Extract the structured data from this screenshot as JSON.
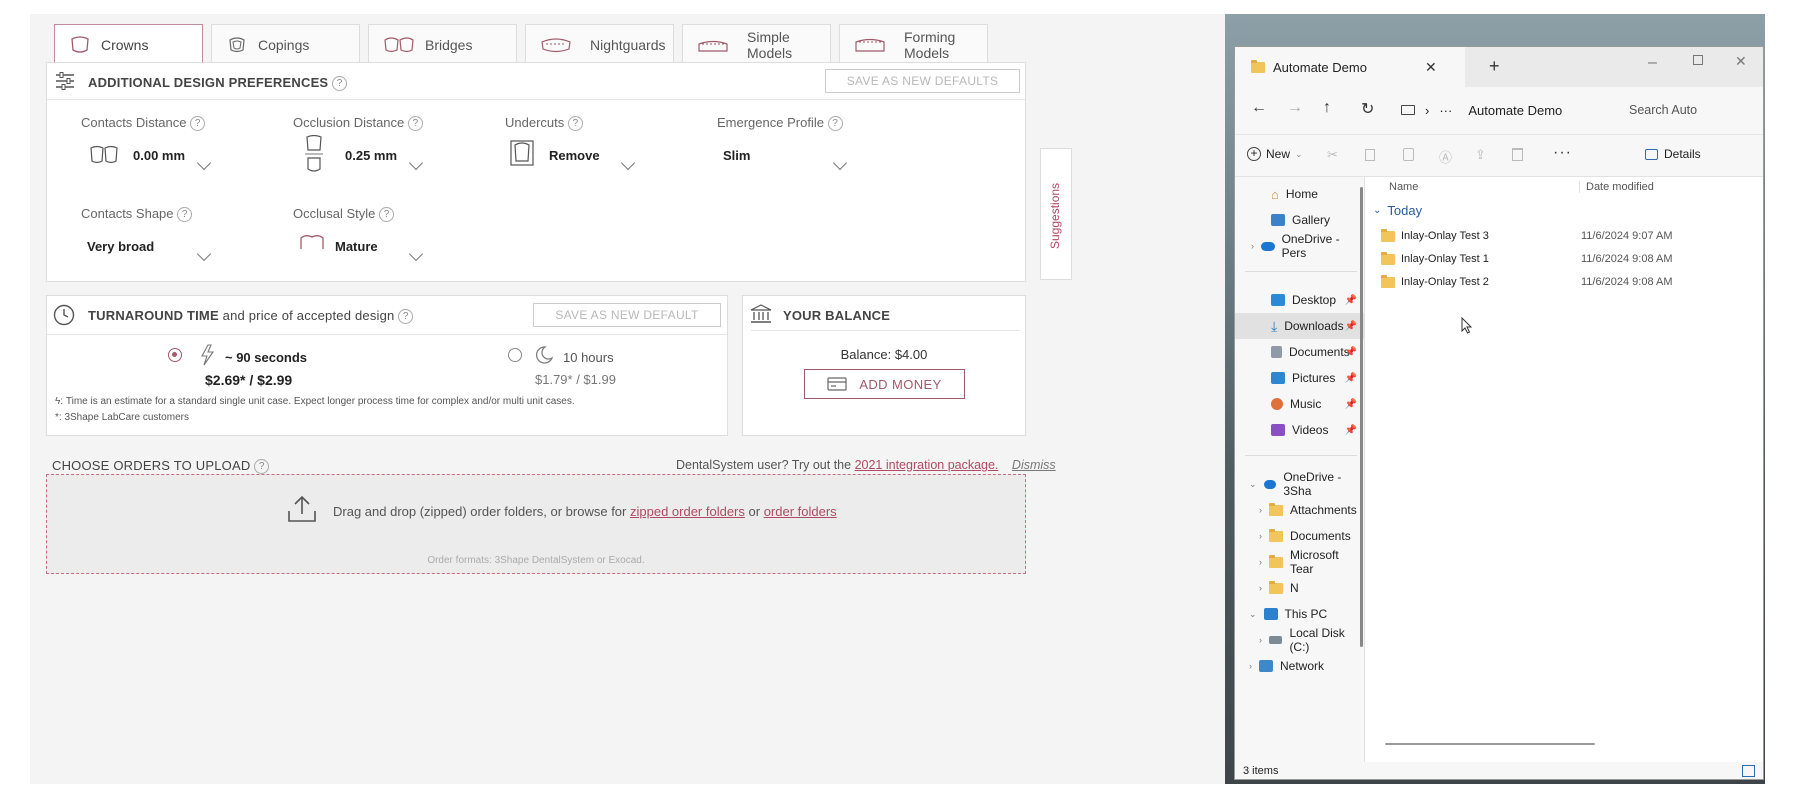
{
  "tabs": [
    {
      "label": "Crowns",
      "active": true
    },
    {
      "label": "Copings",
      "active": false
    },
    {
      "label": "Bridges",
      "active": false
    },
    {
      "label": "Nightguards",
      "active": false
    },
    {
      "label": "Simple Models",
      "active": false
    },
    {
      "label": "Forming Models",
      "active": false
    }
  ],
  "design": {
    "title": "ADDITIONAL DESIGN PREFERENCES",
    "save_label": "SAVE AS NEW DEFAULTS",
    "contacts_distance": {
      "label": "Contacts Distance",
      "value": "0.00 mm"
    },
    "occlusion_distance": {
      "label": "Occlusion Distance",
      "value": "0.25 mm"
    },
    "undercuts": {
      "label": "Undercuts",
      "value": "Remove"
    },
    "emergence_profile": {
      "label": "Emergence Profile",
      "value": "Slim"
    },
    "contacts_shape": {
      "label": "Contacts Shape",
      "value": "Very broad"
    },
    "occlusal_style": {
      "label": "Occlusal Style",
      "value": "Mature"
    }
  },
  "suggestions_label": "Suggestions",
  "turnaround": {
    "title_bold": "TURNAROUND TIME",
    "title_rest": " and price of accepted design",
    "save_label": "SAVE AS NEW DEFAULT",
    "option1": {
      "time": "~ 90 seconds",
      "price": "$2.69* / $2.99",
      "selected": true
    },
    "option2": {
      "time": "10 hours",
      "price": "$1.79* / $1.99",
      "selected": false
    },
    "note1": ": Time is an estimate for a standard single unit case. Expect longer process time for complex and/or multi unit cases.",
    "note2": "*: 3Shape LabCare customers"
  },
  "balance": {
    "title": "YOUR BALANCE",
    "text": "Balance: $4.00",
    "add_money": "ADD MONEY"
  },
  "upload": {
    "title": "CHOOSE ORDERS TO UPLOAD",
    "prompt": "DentalSystem user? Try out the ",
    "integration_link": "2021 integration package.",
    "dismiss": "Dismiss",
    "drop_text": "Drag and drop (zipped) order folders, or browse for ",
    "zipped_link": "zipped order folders",
    "or_text": " or ",
    "folders_link": "order folders",
    "formats": "Order formats: 3Shape DentalSystem or Exocad."
  },
  "explorer": {
    "tab_title": "Automate Demo",
    "breadcrumb": "Automate Demo",
    "search_placeholder": "Search Auto",
    "new_label": "New",
    "details_label": "Details",
    "col_name": "Name",
    "col_date": "Date modified",
    "group": "Today",
    "files": [
      {
        "name": "Inlay-Onlay Test 3",
        "date": "11/6/2024 9:07 AM"
      },
      {
        "name": "Inlay-Onlay Test 1",
        "date": "11/6/2024 9:08 AM"
      },
      {
        "name": "Inlay-Onlay Test 2",
        "date": "11/6/2024 9:08 AM"
      }
    ],
    "nav": {
      "home": "Home",
      "gallery": "Gallery",
      "onedrive_personal": "OneDrive - Pers",
      "desktop": "Desktop",
      "downloads": "Downloads",
      "documents": "Documents",
      "pictures": "Pictures",
      "music": "Music",
      "videos": "Videos",
      "onedrive_3sha": "OneDrive - 3Sha",
      "attachments": "Attachments",
      "documents2": "Documents",
      "microsoft_teams": "Microsoft Tear",
      "n": "N",
      "this_pc": "This PC",
      "local_disk": "Local Disk (C:)",
      "network": "Network"
    },
    "status": "3 items"
  }
}
